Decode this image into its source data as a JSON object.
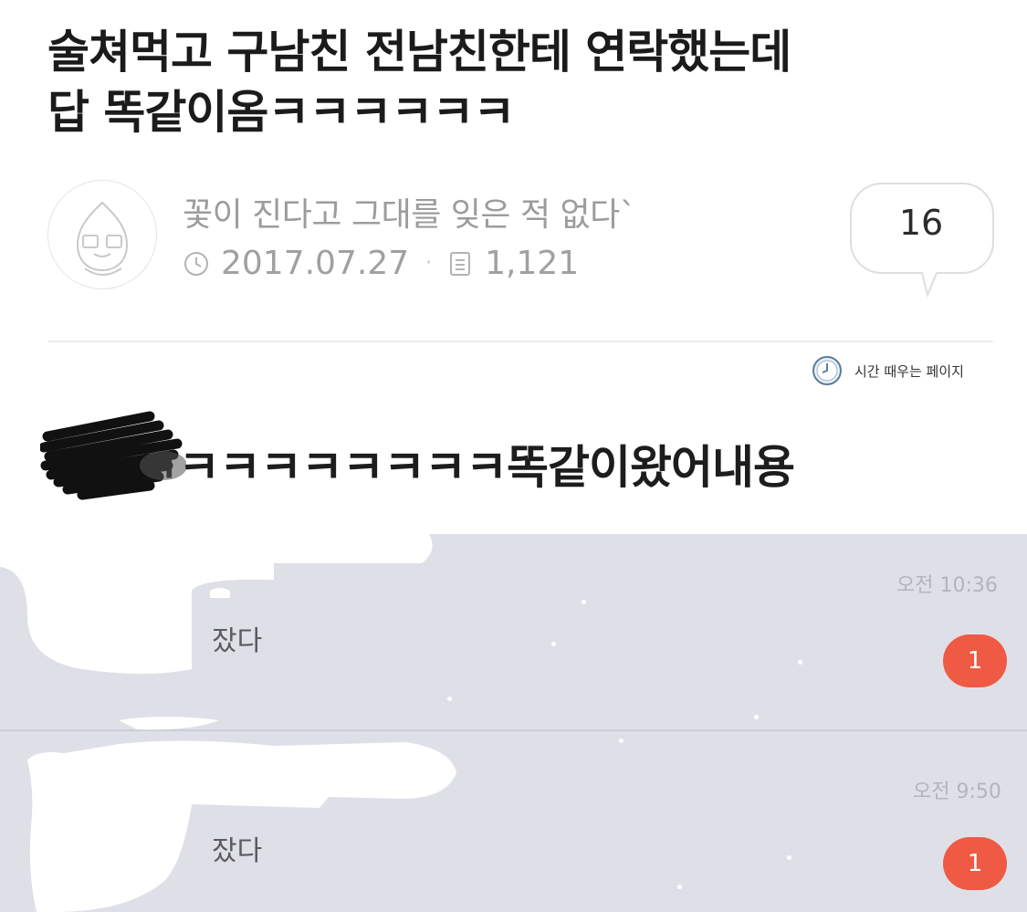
{
  "post": {
    "title_line1": "술쳐먹고 구남친 전남친한테 연락했는데",
    "title_line2": "답 똑같이옴ㅋㅋㅋㅋㅋㅋ",
    "author": "꽃이 진다고 그대를 잊은 적 없다`",
    "date": "2017.07.27",
    "views": "1,121",
    "comment_count": "16",
    "board_link": "시간 때우는 페이지",
    "body_text": "ㅋㅋㅋㅋㅋㅋㅋㅋㅋ똑같이왔어내용"
  },
  "chat_list": [
    {
      "message": "잤다",
      "time": "오전 10:36",
      "unread": "1"
    },
    {
      "message": "잤다",
      "time": "오전 9:50",
      "unread": "1"
    }
  ],
  "colors": {
    "badge": "#ee5a43",
    "chat_bg": "#dfe0e7"
  },
  "icons": [
    "clock-icon",
    "document-icon",
    "speech-bubble-icon",
    "timer-icon"
  ]
}
